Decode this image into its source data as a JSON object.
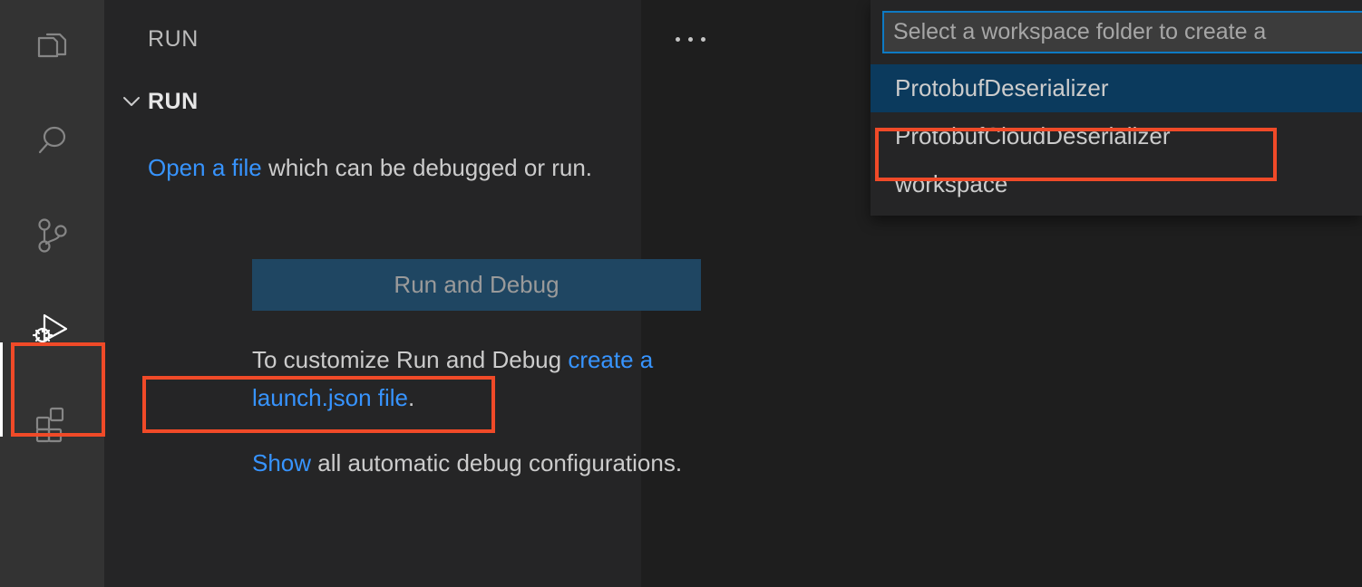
{
  "activity_bar": {
    "items": [
      {
        "name": "explorer",
        "icon": "files-icon",
        "active": false
      },
      {
        "name": "search",
        "icon": "search-icon",
        "active": false
      },
      {
        "name": "source-control",
        "icon": "source-control-icon",
        "active": false
      },
      {
        "name": "run-and-debug",
        "icon": "run-and-debug-icon",
        "active": true
      },
      {
        "name": "extensions",
        "icon": "extensions-icon",
        "active": false
      }
    ]
  },
  "sidebar": {
    "title": "RUN",
    "more_actions_icon": "ellipsis-icon",
    "section": {
      "chevron_icon": "chevron-down-icon",
      "title": "RUN"
    },
    "welcome": {
      "open_file_link": "Open a file",
      "open_file_rest": " which can be debugged or run.",
      "run_debug_button": "Run and Debug",
      "customize_prefix": "To customize Run and Debug ",
      "customize_link": "create a launch.json file",
      "customize_suffix": ".",
      "show_link": "Show",
      "show_rest": " all automatic debug configurations."
    }
  },
  "quick_pick": {
    "input_placeholder": "Select a workspace folder to create a",
    "input_value": "",
    "items": [
      {
        "label": "ProtobufDeserializer",
        "selected": true
      },
      {
        "label": "ProtobufCloudDeserializer",
        "selected": false
      },
      {
        "label": "workspace",
        "selected": false
      }
    ]
  },
  "annotations": {
    "color": "#f04a28",
    "boxes": [
      {
        "name": "run-and-debug-activity-icon"
      },
      {
        "name": "create-launch-json-link"
      },
      {
        "name": "protobuf-cloud-deserializer-item"
      }
    ]
  },
  "colors": {
    "activity_bar_bg": "#333333",
    "sidebar_bg": "#252526",
    "editor_bg": "#1e1e1e",
    "link_blue": "#3794ff",
    "button_bg": "#1f4662",
    "selection_blue": "#0b3a5d",
    "input_border_blue": "#0e7ac4"
  }
}
